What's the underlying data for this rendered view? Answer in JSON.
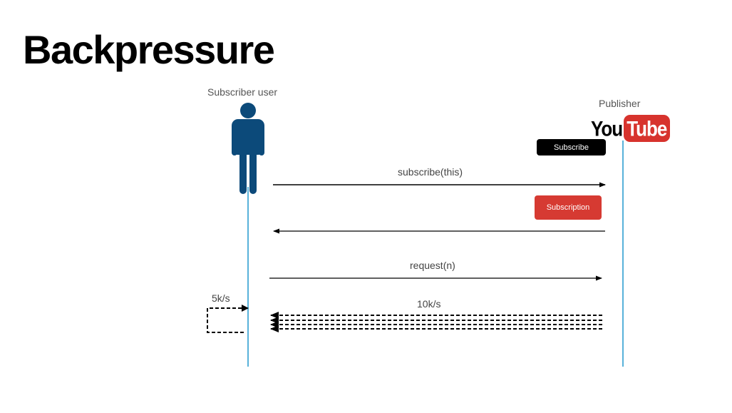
{
  "slide": {
    "title": "Backpressure"
  },
  "actors": {
    "subscriber": {
      "label": "Subscriber user"
    },
    "publisher": {
      "label": "Publisher",
      "logo": {
        "part1": "You",
        "part2": "Tube"
      }
    }
  },
  "badges": {
    "subscribe": "Subscribe",
    "subscription": "Subscription"
  },
  "messages": {
    "subscribe_call": "subscribe(this)",
    "request_call": "request(n)",
    "publisher_rate": "10k/s",
    "subscriber_rate": "5k/s"
  },
  "colors": {
    "actor": "#0c4a7a",
    "lifeline": "#2e9fd0",
    "youtube_red": "#d7332d",
    "subscribe_badge": "#000000",
    "subscription_badge": "#d63a32",
    "arrow": "#000000"
  },
  "icons": {
    "subscriber": "person-icon"
  }
}
